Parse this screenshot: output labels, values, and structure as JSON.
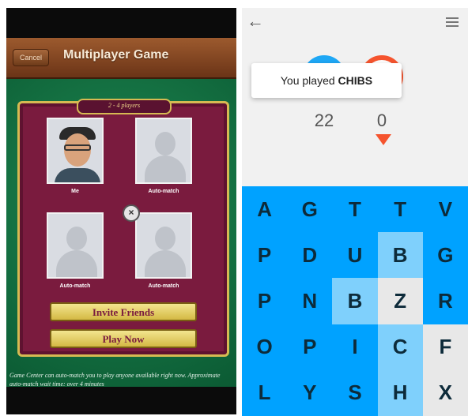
{
  "game_center": {
    "cancel_label": "Cancel",
    "title": "Multiplayer Game",
    "players_banner": "2 - 4 players",
    "slots": [
      {
        "label": "Me"
      },
      {
        "label": "Auto-match"
      },
      {
        "label": "Auto-match"
      },
      {
        "label": "Auto-match"
      }
    ],
    "invite_label": "Invite Friends",
    "play_label": "Play Now",
    "footer_text": "Game Center can auto-match you to play anyone available right now. Approximate auto-match wait time: over 4 minutes"
  },
  "letterpress": {
    "toast_prefix": "You played",
    "toast_word": "CHIBS",
    "score_blue": "22",
    "score_red": "0",
    "colors": {
      "blue": "#00a2ff",
      "light_blue": "#7fd0fc",
      "light_gray": "#e8e8e8",
      "red": "#f5542e"
    },
    "board": [
      [
        {
          "letter": "A",
          "state": "blue"
        },
        {
          "letter": "G",
          "state": "blue"
        },
        {
          "letter": "T",
          "state": "blue"
        },
        {
          "letter": "T",
          "state": "blue"
        },
        {
          "letter": "V",
          "state": "blue"
        }
      ],
      [
        {
          "letter": "P",
          "state": "blue"
        },
        {
          "letter": "D",
          "state": "blue"
        },
        {
          "letter": "U",
          "state": "blue"
        },
        {
          "letter": "B",
          "state": "light_blue"
        },
        {
          "letter": "G",
          "state": "blue"
        }
      ],
      [
        {
          "letter": "P",
          "state": "blue"
        },
        {
          "letter": "N",
          "state": "blue"
        },
        {
          "letter": "B",
          "state": "light_blue"
        },
        {
          "letter": "Z",
          "state": "light_gray"
        },
        {
          "letter": "R",
          "state": "blue"
        }
      ],
      [
        {
          "letter": "O",
          "state": "blue"
        },
        {
          "letter": "P",
          "state": "blue"
        },
        {
          "letter": "I",
          "state": "blue"
        },
        {
          "letter": "C",
          "state": "light_blue"
        },
        {
          "letter": "F",
          "state": "light_gray"
        }
      ],
      [
        {
          "letter": "L",
          "state": "blue"
        },
        {
          "letter": "Y",
          "state": "blue"
        },
        {
          "letter": "S",
          "state": "blue"
        },
        {
          "letter": "H",
          "state": "light_blue"
        },
        {
          "letter": "X",
          "state": "light_gray"
        }
      ]
    ]
  }
}
